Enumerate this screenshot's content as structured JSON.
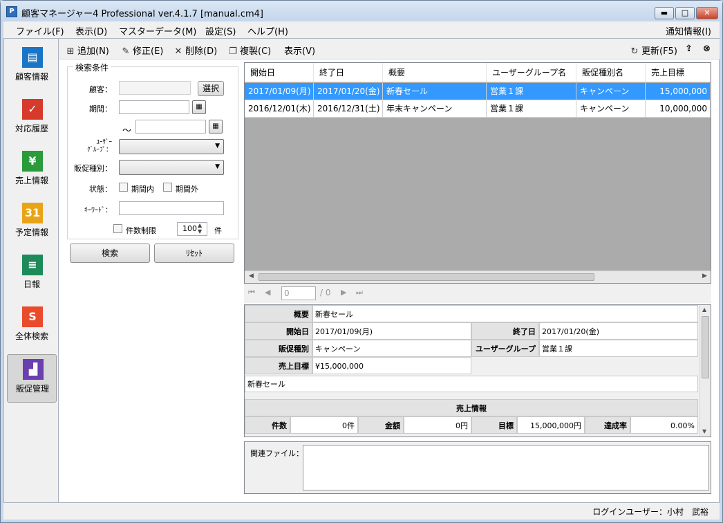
{
  "window": {
    "title": "顧客マネージャー4 Professional ver.4.1.7 [manual.cm4]",
    "app_icon_text": "P",
    "minimize": "▬",
    "maximize": "□",
    "close": "✕"
  },
  "menu": {
    "file": "ファイル(F)",
    "view": "表示(D)",
    "master": "マスターデータ(M)",
    "settings": "設定(S)",
    "help": "ヘルプ(H)",
    "notify": "通知情報(I)"
  },
  "nav": [
    {
      "label": "顧客情報",
      "icon": "customer-card-icon",
      "color": "#1a75c7",
      "glyph": "▤"
    },
    {
      "label": "対応履歴",
      "icon": "check-pen-icon",
      "color": "#d53a2a",
      "glyph": "✓"
    },
    {
      "label": "売上情報",
      "icon": "yen-icon",
      "color": "#2a9a3a",
      "glyph": "¥"
    },
    {
      "label": "予定情報",
      "icon": "calendar-31-icon",
      "color": "#e8a317",
      "glyph": "31"
    },
    {
      "label": "日報",
      "icon": "report-icon",
      "color": "#1d8a5a",
      "glyph": "≡"
    },
    {
      "label": "全体検索",
      "icon": "search-s-icon",
      "color": "#e94b2d",
      "glyph": "S"
    },
    {
      "label": "販促管理",
      "icon": "bar-chart-icon",
      "color": "#6a3fb0",
      "glyph": "▟"
    }
  ],
  "toolbar": {
    "add": "追加(N)",
    "edit": "修正(E)",
    "delete": "削除(D)",
    "copy": "複製(C)",
    "view": "表示(V)",
    "refresh": "更新(F5)"
  },
  "search": {
    "group_title": "検索条件",
    "customer_label": "顧客：",
    "customer_button": "選択",
    "period_label": "期間：",
    "tilde": "～",
    "user_group_label_1": "ﾕｰｻﾞｰ",
    "user_group_label_2": "ｸﾞﾙｰﾌﾟ：",
    "promo_type_label": "販促種別：",
    "status_label": "状態：",
    "within_period": "期間内",
    "outside_period": "期間外",
    "keyword_label": "ｷｰﾜｰﾄﾞ：",
    "limit_label": "件数制限",
    "limit_value": "100",
    "limit_unit": "件",
    "search_button": "検索",
    "reset_button": "ﾘｾｯﾄ"
  },
  "grid": {
    "columns": [
      "開始日",
      "終了日",
      "概要",
      "ユーザーグループ名",
      "販促種別名",
      "売上目標"
    ],
    "rows": [
      [
        "2017/01/09(月)",
        "2017/01/20(金)",
        "新春セール",
        "営業１課",
        "キャンペーン",
        "15,000,000"
      ],
      [
        "2016/12/01(木)",
        "2016/12/31(土)",
        "年末キャンペーン",
        "営業１課",
        "キャンペーン",
        "10,000,000"
      ]
    ]
  },
  "pager": {
    "page": "0",
    "total": "/ 0"
  },
  "detail": {
    "summary_label": "概要",
    "summary_value": "新春セール",
    "start_label": "開始日",
    "start_value": "2017/01/09(月)",
    "end_label": "終了日",
    "end_value": "2017/01/20(金)",
    "promo_label": "販促種別",
    "promo_value": "キャンペーン",
    "group_label": "ユーザーグループ",
    "group_value": "営業１課",
    "target_label": "売上目標",
    "target_value": "¥15,000,000",
    "memo": "新春セール",
    "sales_header": "売上情報",
    "count_label": "件数",
    "count_value": "0件",
    "amount_label": "金額",
    "amount_value": "0円",
    "goal_label": "目標",
    "goal_value": "15,000,000円",
    "rate_label": "達成率",
    "rate_value": "0.00%"
  },
  "files": {
    "label": "関連ファイル："
  },
  "status": {
    "login": "ログインユーザー：小村　武裕"
  }
}
